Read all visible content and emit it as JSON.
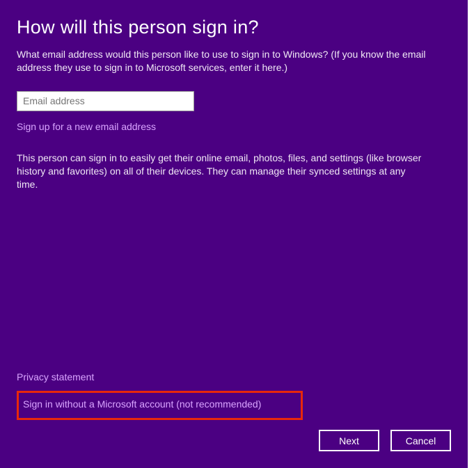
{
  "heading": "How will this person sign in?",
  "intro": "What email address would this person like to use to sign in to Windows? (If you know the email address they use to sign in to Microsoft services, enter it here.)",
  "email": {
    "placeholder": "Email address",
    "value": ""
  },
  "signup_link": "Sign up for a new email address",
  "description": "This person can sign in to easily get their online email, photos, files, and settings (like browser history and favorites) on all of their devices. They can manage their synced settings at any time.",
  "privacy_link": "Privacy statement",
  "no_ms_account_link": "Sign in without a Microsoft account (not recommended)",
  "buttons": {
    "next": "Next",
    "cancel": "Cancel"
  }
}
